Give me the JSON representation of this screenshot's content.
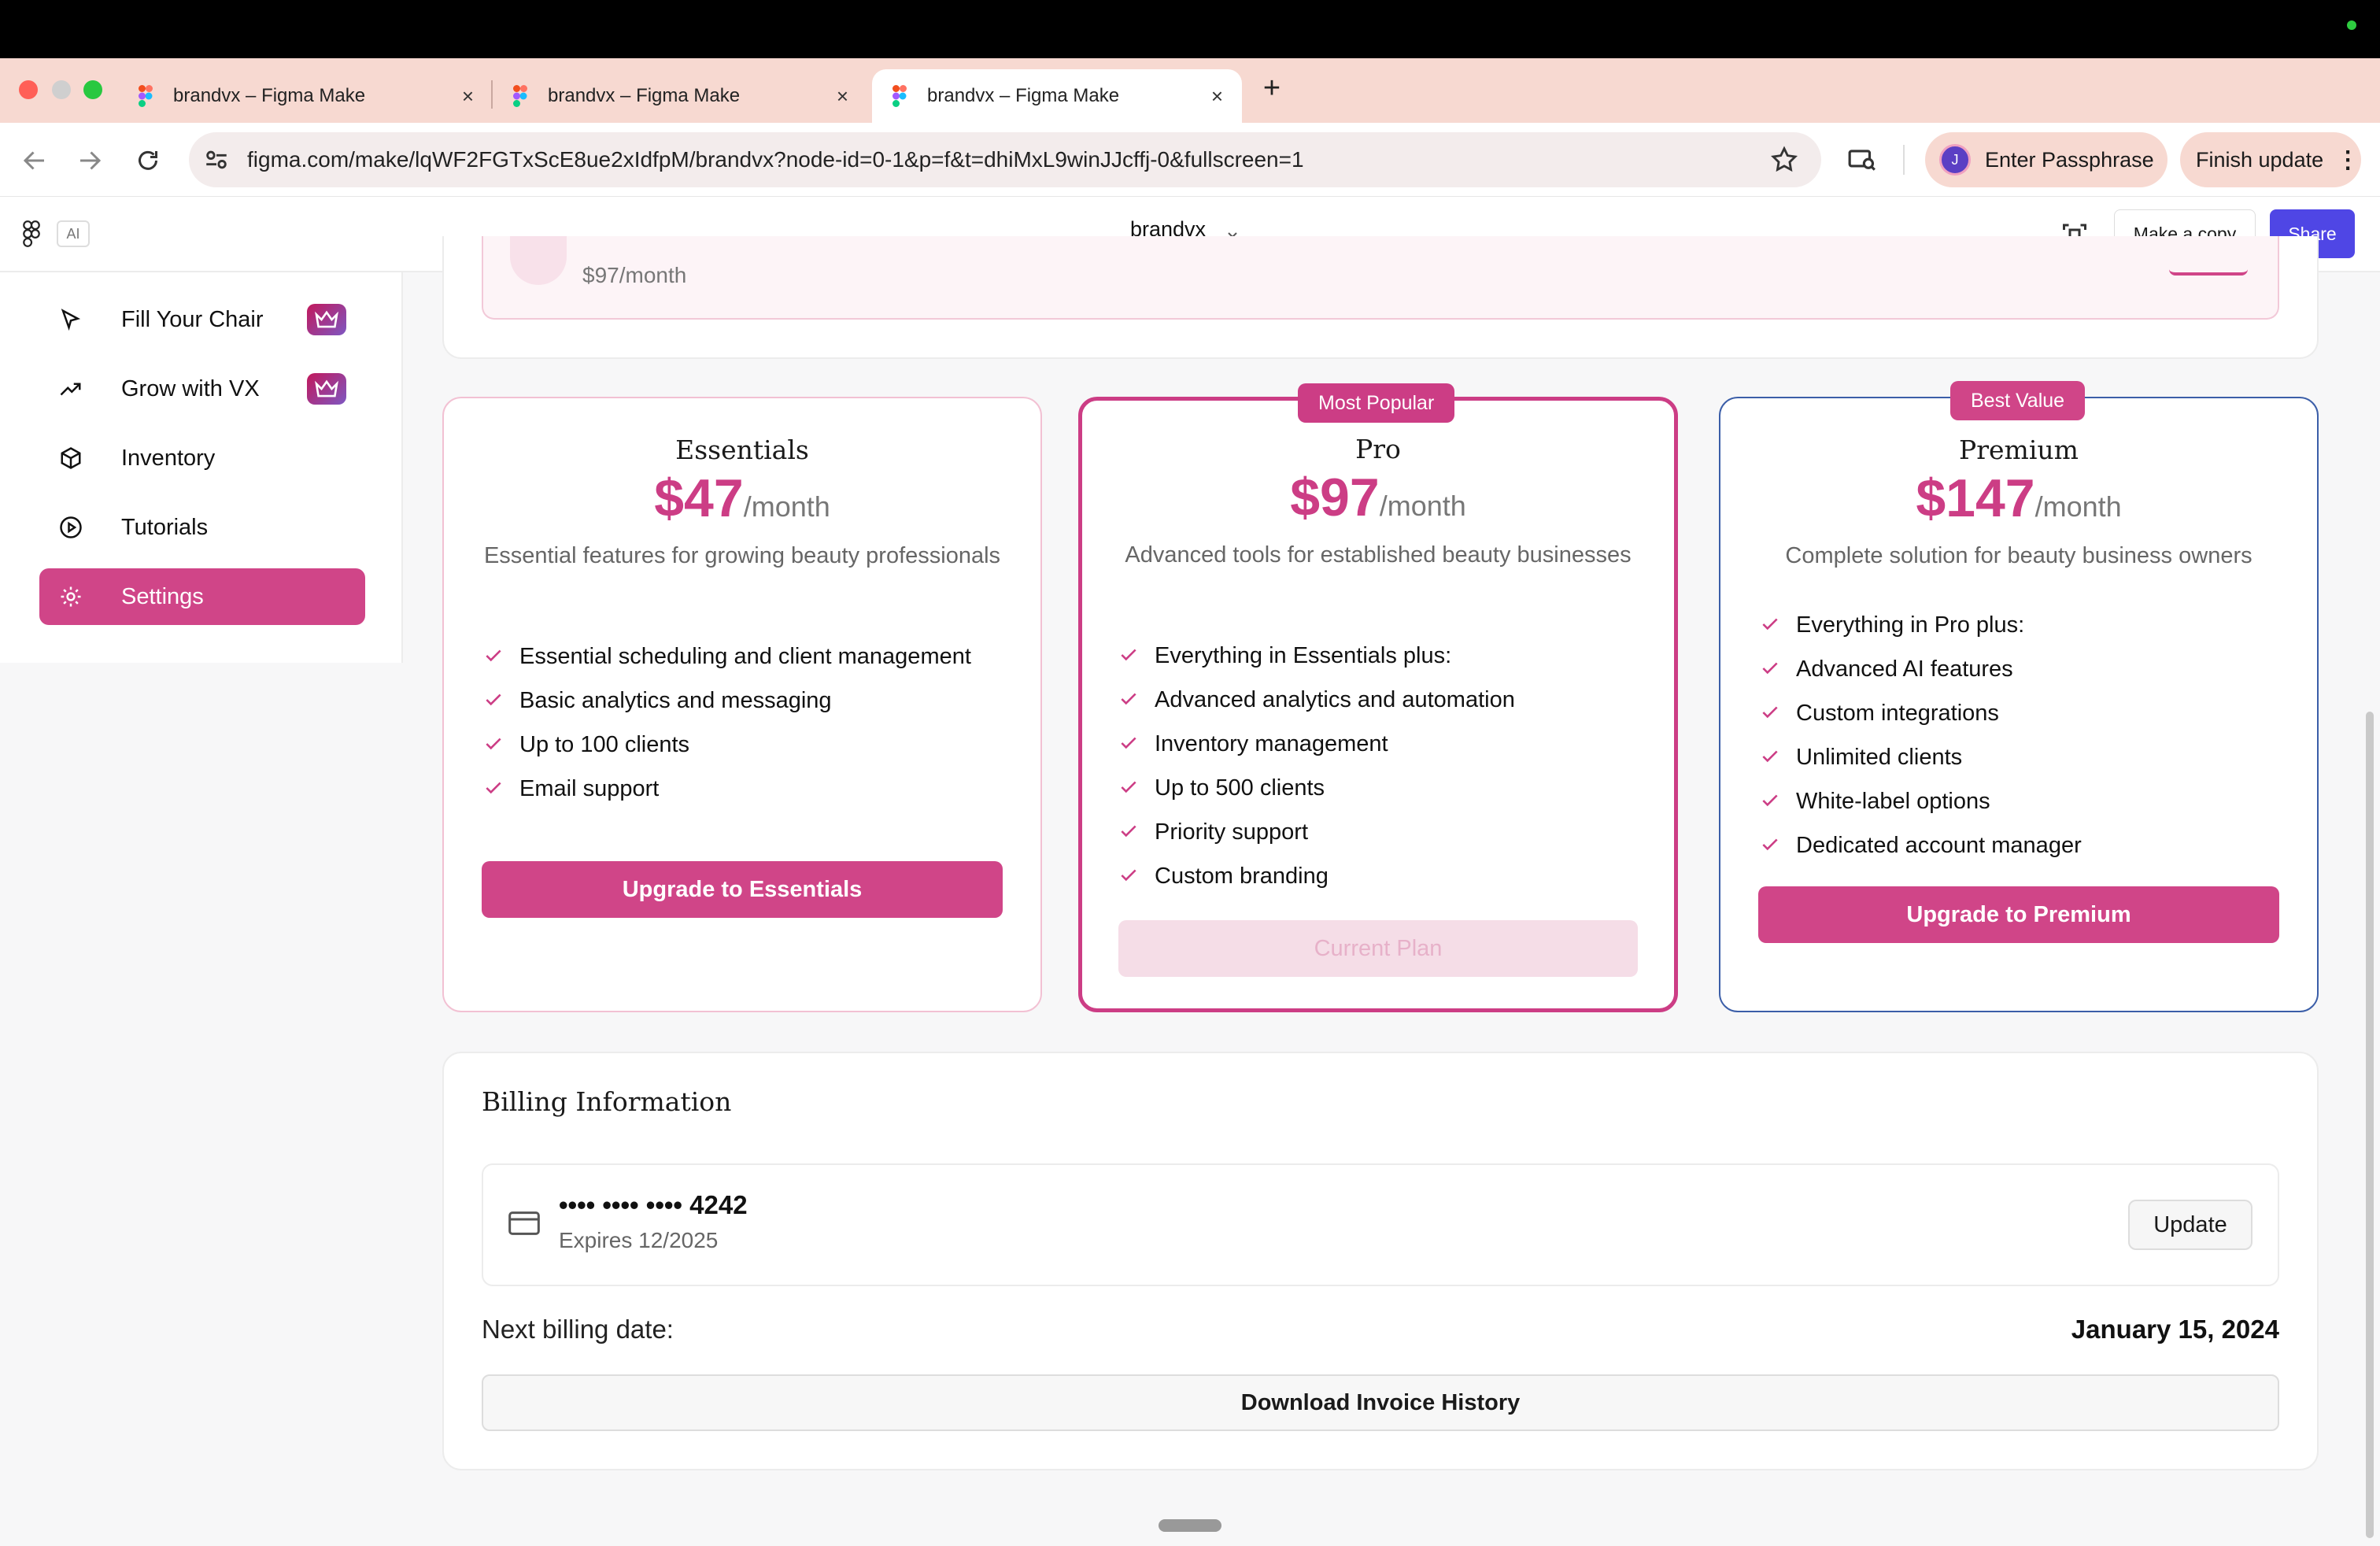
{
  "browser": {
    "tabs": [
      {
        "title": "brandvx – Figma Make",
        "close": "×"
      },
      {
        "title": "brandvx – Figma Make",
        "close": "×"
      },
      {
        "title": "brandvx – Figma Make",
        "close": "×"
      }
    ],
    "new_tab": "+",
    "url": "figma.com/make/lqWF2FGTxScE8ue2xIdfpM/brandvx?node-id=0-1&p=f&t=dhiMxL9winJJcffj-0&fullscreen=1",
    "profile_initial": "J",
    "passphrase_label": "Enter Passphrase",
    "finish_update_label": "Finish update"
  },
  "figma": {
    "ai_badge": "AI",
    "file_title": "brandvx",
    "make_copy_label": "Make a copy",
    "share_label": "Share"
  },
  "sidebar": {
    "items": [
      {
        "label": "Fill Your Chair",
        "icon": "cursor-arrow-icon",
        "premium": true
      },
      {
        "label": "Grow with VX",
        "icon": "trending-up-icon",
        "premium": true
      },
      {
        "label": "Inventory",
        "icon": "box-icon",
        "premium": false
      },
      {
        "label": "Tutorials",
        "icon": "play-circle-icon",
        "premium": false
      },
      {
        "label": "Settings",
        "icon": "gear-icon",
        "premium": false,
        "active": true
      }
    ]
  },
  "current_plan_banner": {
    "price": "$97/month"
  },
  "plans": [
    {
      "name": "Essentials",
      "amount": "$47",
      "period": "/month",
      "description": "Essential features for growing beauty professionals",
      "features": [
        "Essential scheduling and client management",
        "Basic analytics and messaging",
        "Up to 100 clients",
        "Email support"
      ],
      "button": "Upgrade to Essentials"
    },
    {
      "name": "Pro",
      "badge": "Most Popular",
      "amount": "$97",
      "period": "/month",
      "description": "Advanced tools for established beauty businesses",
      "features": [
        "Everything in Essentials plus:",
        "Advanced analytics and automation",
        "Inventory management",
        "Up to 500 clients",
        "Priority support",
        "Custom branding"
      ],
      "button": "Current Plan"
    },
    {
      "name": "Premium",
      "badge": "Best Value",
      "amount": "$147",
      "period": "/month",
      "description": "Complete solution for beauty business owners",
      "features": [
        "Everything in Pro plus:",
        "Advanced AI features",
        "Custom integrations",
        "Unlimited clients",
        "White-label options",
        "Dedicated account manager"
      ],
      "button": "Upgrade to Premium"
    }
  ],
  "billing": {
    "title": "Billing Information",
    "card_number": "•••• •••• •••• 4242",
    "expires": "Expires 12/2025",
    "update_label": "Update",
    "next_billing_label": "Next billing date:",
    "next_billing_date": "January 15, 2024",
    "invoice_label": "Download Invoice History"
  },
  "colors": {
    "accent": "#d04588",
    "pro_border": "#cc3d85",
    "premium_border": "#3b5ea8",
    "premium_badge": "#d04588",
    "share_button": "#4f46e5",
    "tab_strip": "#f7d9d1"
  }
}
